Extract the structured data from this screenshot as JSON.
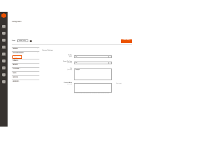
{
  "header": {
    "title": "Configuration",
    "scope_label": "Scope:",
    "scope_value": "Default Config",
    "help_symbol": "?",
    "save_label": "Save Config"
  },
  "admin_nav": [
    {
      "label": "Dashboard",
      "icon": "dashboard-icon"
    },
    {
      "label": "Sales",
      "icon": "dollar-icon"
    },
    {
      "label": "Catalog",
      "icon": "box-icon"
    },
    {
      "label": "Customers",
      "icon": "people-icon"
    },
    {
      "label": "Marketing",
      "icon": "megaphone-icon"
    },
    {
      "label": "Content",
      "icon": "layout-icon"
    },
    {
      "label": "Reports",
      "icon": "bar-chart-icon"
    },
    {
      "label": "Stores",
      "icon": "store-icon"
    },
    {
      "label": "System",
      "icon": "gear-icon"
    }
  ],
  "tabs": {
    "group_1": "GENERAL",
    "group_2": "SITE IMPROVEMENTS",
    "active_sub": "Settings",
    "more": [
      "CATALOG",
      "SECURITY",
      "CUSTOMERS",
      "SALES",
      "SERVICES",
      "ADVANCED"
    ],
    "chevron": "⌄"
  },
  "main": {
    "section_title": "General Settings",
    "fields": [
      {
        "label": "Enable",
        "scope": "[global]",
        "value": "Yes"
      },
      {
        "label": "Prevent Text Copy",
        "scope": "[store view]",
        "value": "Yes"
      },
      {
        "label": "Text",
        "scope": "[store view]",
        "value": "Copyright"
      },
      {
        "label": "Protected Areas",
        "scope": "[store view]",
        "value": ""
      }
    ],
    "side_note": "Save to apply",
    "under_note": "Use comma to separate multiple CSS selectors. Protection will be applied to selected page areas."
  },
  "colors": {
    "accent": "#eb5202",
    "nav_bg": "#373330"
  }
}
